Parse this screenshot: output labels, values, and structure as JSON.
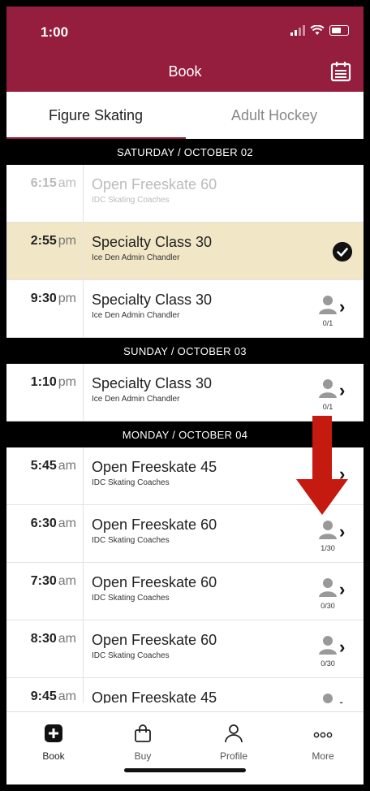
{
  "status": {
    "time": "1:00"
  },
  "header": {
    "title": "Book",
    "calendar_icon": "calendar-icon"
  },
  "tabs": [
    {
      "label": "Figure Skating"
    },
    {
      "label": "Adult Hockey"
    }
  ],
  "days": [
    {
      "label": "SATURDAY / OCTOBER 02"
    },
    {
      "label": "SUNDAY / OCTOBER 03"
    },
    {
      "label": "MONDAY / OCTOBER 04"
    }
  ],
  "sessions": [
    {
      "hour": "6:15",
      "ampm": "am",
      "name": "Open Freeskate 60",
      "coach": "IDC Skating Coaches"
    },
    {
      "hour": "2:55",
      "ampm": "pm",
      "name": "Specialty Class 30",
      "coach": "Ice Den Admin Chandler"
    },
    {
      "hour": "9:30",
      "ampm": "pm",
      "name": "Specialty Class 30",
      "coach": "Ice Den Admin Chandler",
      "count": "0/1"
    },
    {
      "hour": "1:10",
      "ampm": "pm",
      "name": "Specialty Class 30",
      "coach": "Ice Den Admin Chandler",
      "count": "0/1"
    },
    {
      "hour": "5:45",
      "ampm": "am",
      "name": "Open Freeskate 45",
      "coach": "IDC Skating Coaches"
    },
    {
      "hour": "6:30",
      "ampm": "am",
      "name": "Open Freeskate 60",
      "coach": "IDC Skating Coaches",
      "count": "1/30"
    },
    {
      "hour": "7:30",
      "ampm": "am",
      "name": "Open Freeskate 60",
      "coach": "IDC Skating Coaches",
      "count": "0/30"
    },
    {
      "hour": "8:30",
      "ampm": "am",
      "name": "Open Freeskate 60",
      "coach": "IDC Skating Coaches",
      "count": "0/30"
    },
    {
      "hour": "9:45",
      "ampm": "am",
      "name": "Open Freeskate 45"
    }
  ],
  "tabbar": [
    {
      "label": "Book",
      "icon": "plus-square-icon"
    },
    {
      "label": "Buy",
      "icon": "shopping-bag-icon"
    },
    {
      "label": "Profile",
      "icon": "person-icon"
    },
    {
      "label": "More",
      "icon": "more-dots-icon"
    }
  ],
  "colors": {
    "brand": "#951d3d",
    "selected_row": "#f1e7c6",
    "arrow": "#c41a0f"
  }
}
